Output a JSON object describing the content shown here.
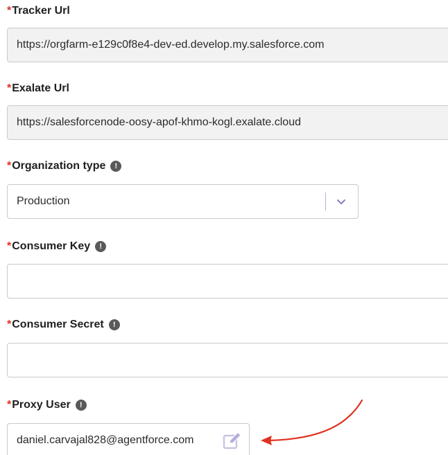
{
  "fields": {
    "tracker_url": {
      "required_mark": "*",
      "label": "Tracker Url",
      "value": "https://orgfarm-e129c0f8e4-dev-ed.develop.my.salesforce.com"
    },
    "exalate_url": {
      "required_mark": "*",
      "label": "Exalate Url",
      "value": "https://salesforcenode-oosy-apof-khmo-kogl.exalate.cloud"
    },
    "organization_type": {
      "required_mark": "*",
      "label": "Organization type",
      "info_icon": "!",
      "selected": "Production"
    },
    "consumer_key": {
      "required_mark": "*",
      "label": "Consumer Key",
      "info_icon": "!",
      "value": ""
    },
    "consumer_secret": {
      "required_mark": "*",
      "label": "Consumer Secret",
      "info_icon": "!",
      "value": ""
    },
    "proxy_user": {
      "required_mark": "*",
      "label": "Proxy User",
      "info_icon": "!",
      "value": "daniel.carvajal828@agentforce.com"
    }
  },
  "icons": {
    "info": "exclamation-circle-icon",
    "dropdown": "chevron-down-icon",
    "edit": "edit-icon",
    "annotation": "red-arrow"
  },
  "colors": {
    "required": "#e0301e",
    "readonly_bg": "#f2f2f2",
    "border": "#c9c9c9",
    "accent": "#8a7cc2",
    "arrow": "#e0301e"
  }
}
